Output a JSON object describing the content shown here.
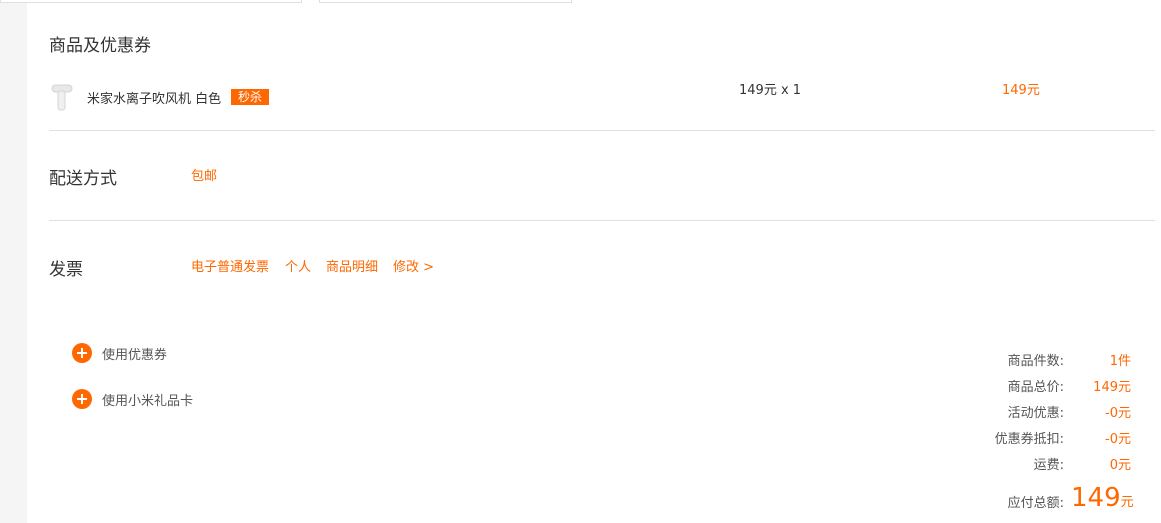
{
  "products_section": {
    "title": "商品及优惠券",
    "items": [
      {
        "name": "米家水离子吹风机 白色",
        "tag": "秒杀",
        "unit_price": "149元 x 1",
        "total": "149元"
      }
    ]
  },
  "shipping": {
    "title": "配送方式",
    "value": "包邮"
  },
  "invoice": {
    "title": "发票",
    "type": "电子普通发票",
    "owner": "个人",
    "content": "商品明细",
    "edit_label": "修改 >"
  },
  "options": {
    "coupon_label": "使用优惠券",
    "giftcard_label": "使用小米礼品卡"
  },
  "summary": {
    "rows": [
      {
        "label": "商品件数:",
        "value": "1件"
      },
      {
        "label": "商品总价:",
        "value": "149元"
      },
      {
        "label": "活动优惠:",
        "value": "-0元"
      },
      {
        "label": "优惠券抵扣:",
        "value": "-0元"
      },
      {
        "label": "运费:",
        "value": "0元"
      }
    ],
    "total_label": "应付总额:",
    "total_amount": "149",
    "total_unit": "元"
  },
  "colors": {
    "accent": "#ff6700",
    "divider": "#e0e0e0",
    "page_bg": "#f5f5f5"
  }
}
